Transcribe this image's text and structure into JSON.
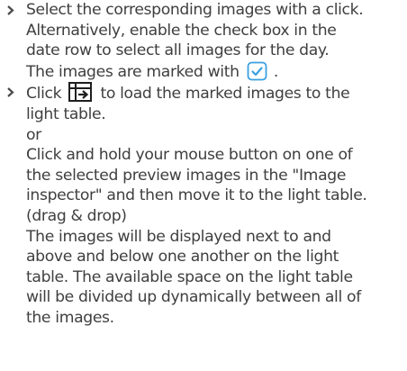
{
  "steps": [
    {
      "lines": [
        "Select the corresponding images with a click.",
        "Alternatively, enable the check box in the",
        "date row to select all images for the day."
      ],
      "marked_pre": "The images are marked with",
      "marked_icon": "checkbox-checked-icon",
      "marked_post": "."
    },
    {
      "first_pre": "Click",
      "first_icon": "load-to-light-table-icon",
      "first_post": "to load the marked images to the",
      "lines": [
        "light table.",
        "or",
        "Click and hold your mouse button on one of",
        "the selected preview images in the \"Image",
        "inspector\" and then move it to the light table.",
        "(drag & drop)",
        "The images will be displayed next to and",
        "above and below one another on the light",
        "table. The available space on the light table",
        "will be divided up dynamically between all of",
        "the images."
      ]
    }
  ],
  "colors": {
    "text": "#3f3f3f",
    "bullet": "#4a4a4a",
    "accent": "#3aa0e0",
    "icon_dark": "#1f1f1f"
  }
}
